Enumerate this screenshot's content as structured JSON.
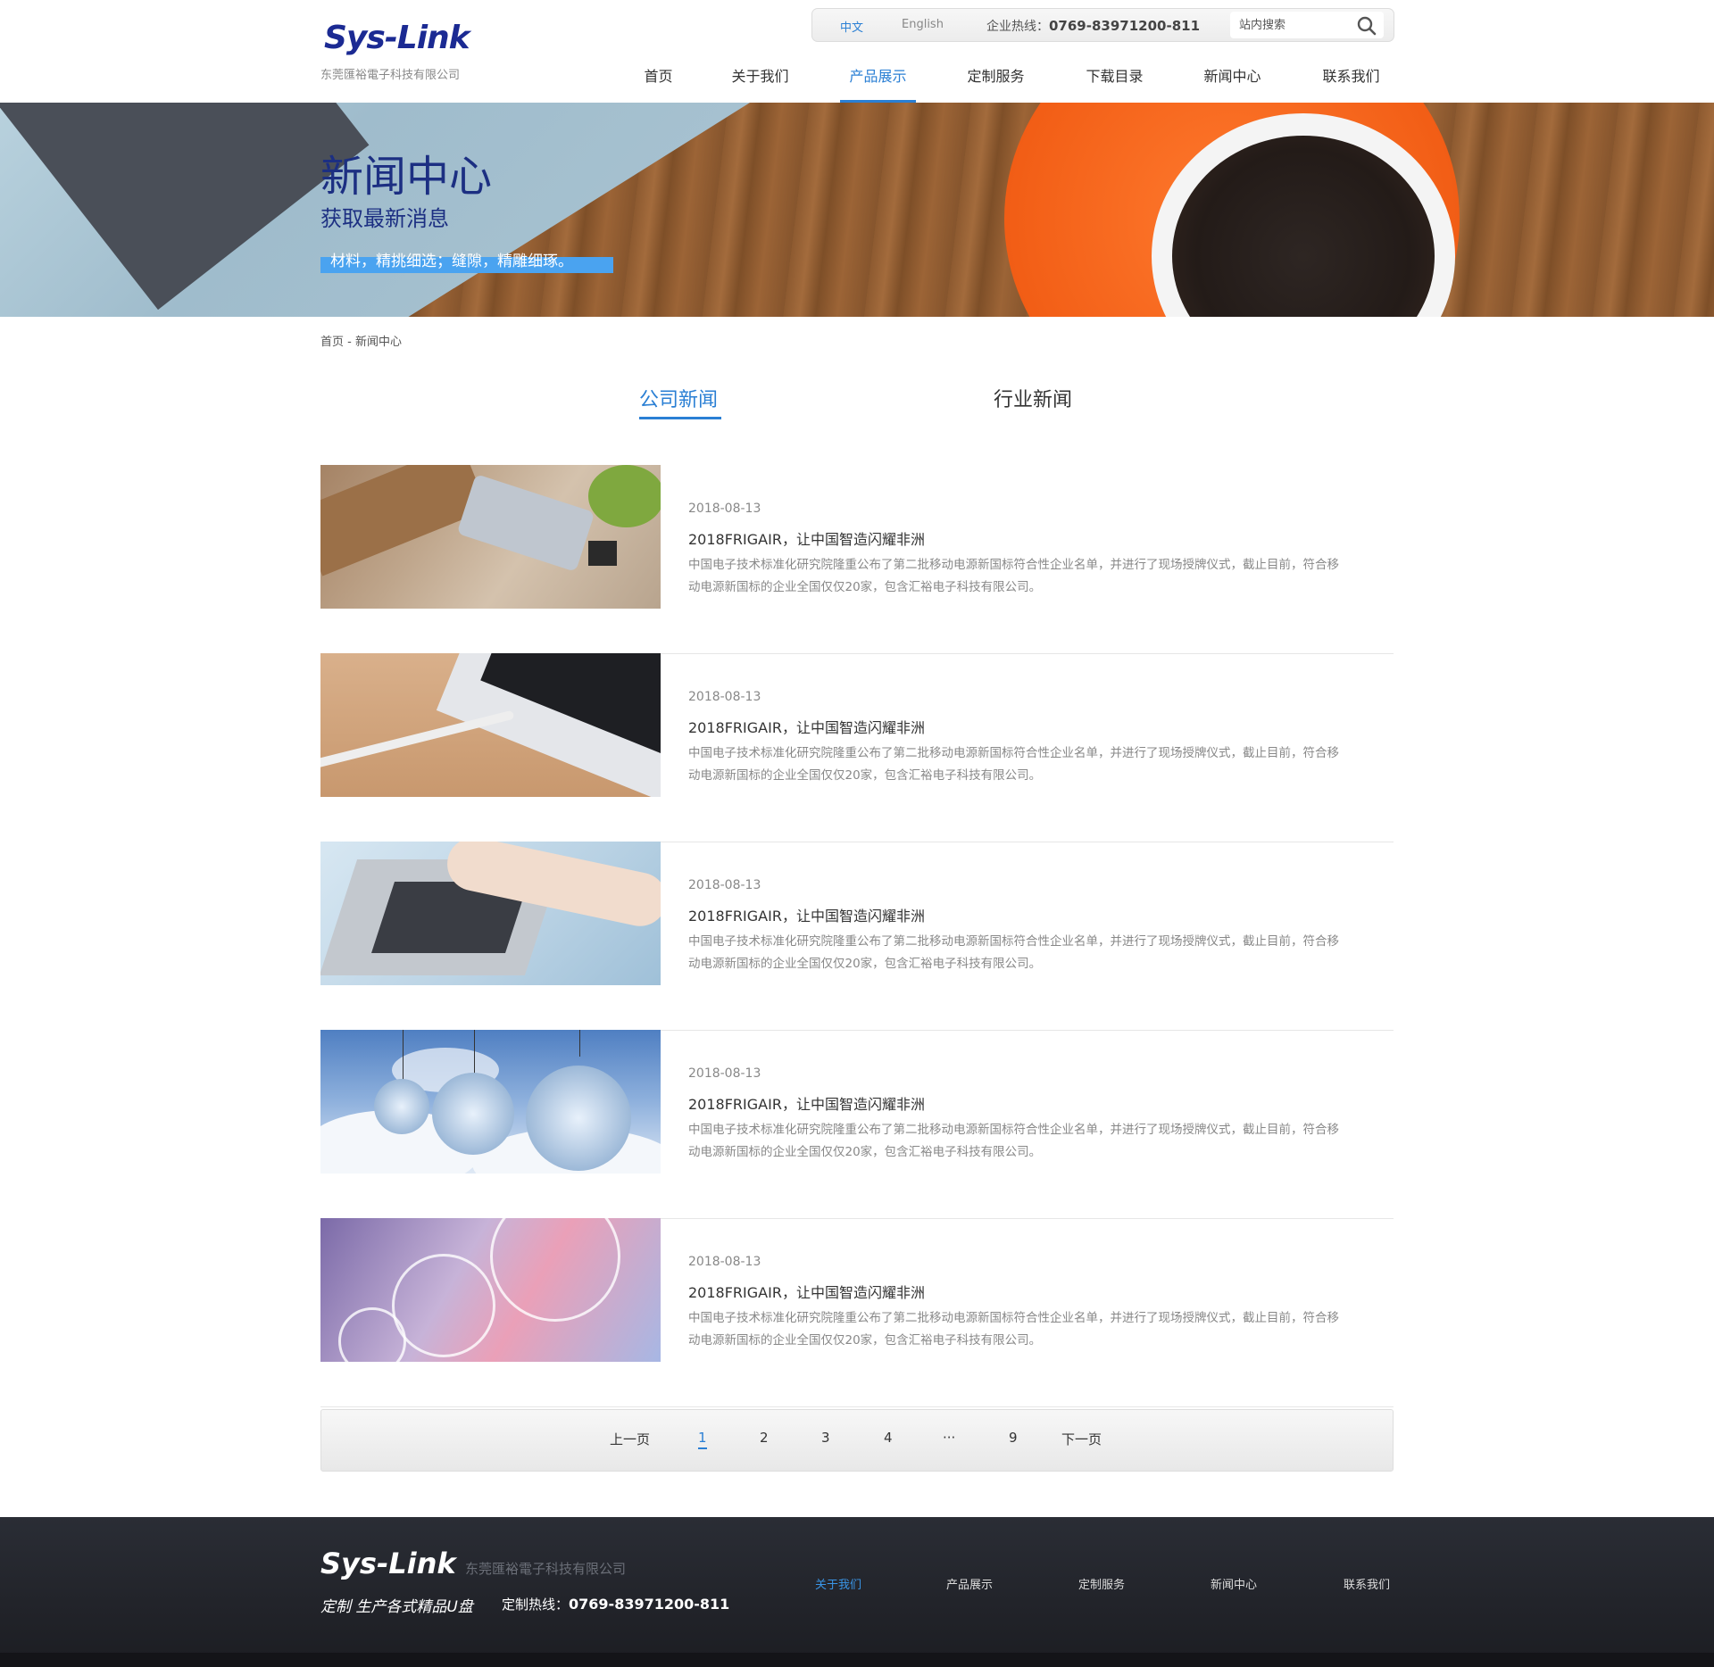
{
  "header": {
    "logo": "Sys-Link",
    "company": "东莞匯裕電子科技有限公司",
    "lang_cn": "中文",
    "lang_en": "English",
    "hotline_label": "企业热线：",
    "hotline_number": "0769-83971200-811",
    "search_placeholder": "站内搜索",
    "search_icon": "search-icon",
    "nav": [
      {
        "label": "首页",
        "active": false
      },
      {
        "label": "关于我们",
        "active": false
      },
      {
        "label": "产品展示",
        "active": true
      },
      {
        "label": "定制服务",
        "active": false
      },
      {
        "label": "下载目录",
        "active": false
      },
      {
        "label": "新闻中心",
        "active": false
      },
      {
        "label": "联系我们",
        "active": false
      }
    ]
  },
  "banner": {
    "title": "新闻中心",
    "subtitle": "获取最新消息",
    "tagline": "材料，精挑细选；缝隙，精雕细琢。"
  },
  "breadcrumb": {
    "home": "首页",
    "separator": "-",
    "current": "新闻中心"
  },
  "tabs": [
    {
      "label": "公司新闻",
      "active": true
    },
    {
      "label": "行业新闻",
      "active": false
    }
  ],
  "news": [
    {
      "date": "2018-08-13",
      "title": "2018FRIGAIR，让中国智造闪耀非洲",
      "desc": "中国电子技术标准化研究院隆重公布了第二批移动电源新国标符合性企业名单，并进行了现场授牌仪式，截止目前，符合移动电源新国标的企业全国仅仅20家，包含汇裕电子科技有限公司。"
    },
    {
      "date": "2018-08-13",
      "title": "2018FRIGAIR，让中国智造闪耀非洲",
      "desc": "中国电子技术标准化研究院隆重公布了第二批移动电源新国标符合性企业名单，并进行了现场授牌仪式，截止目前，符合移动电源新国标的企业全国仅仅20家，包含汇裕电子科技有限公司。"
    },
    {
      "date": "2018-08-13",
      "title": "2018FRIGAIR，让中国智造闪耀非洲",
      "desc": "中国电子技术标准化研究院隆重公布了第二批移动电源新国标符合性企业名单，并进行了现场授牌仪式，截止目前，符合移动电源新国标的企业全国仅仅20家，包含汇裕电子科技有限公司。"
    },
    {
      "date": "2018-08-13",
      "title": "2018FRIGAIR，让中国智造闪耀非洲",
      "desc": "中国电子技术标准化研究院隆重公布了第二批移动电源新国标符合性企业名单，并进行了现场授牌仪式，截止目前，符合移动电源新国标的企业全国仅仅20家，包含汇裕电子科技有限公司。"
    },
    {
      "date": "2018-08-13",
      "title": "2018FRIGAIR，让中国智造闪耀非洲",
      "desc": "中国电子技术标准化研究院隆重公布了第二批移动电源新国标符合性企业名单，并进行了现场授牌仪式，截止目前，符合移动电源新国标的企业全国仅仅20家，包含汇裕电子科技有限公司。"
    }
  ],
  "pagination": {
    "prev": "上一页",
    "pages": [
      "1",
      "2",
      "3",
      "4",
      "···",
      "9"
    ],
    "current": "1",
    "next": "下一页"
  },
  "footer": {
    "logo": "Sys-Link",
    "company": "东莞匯裕電子科技有限公司",
    "slogan": "定制 生产各式精品U盘",
    "hotline_label": "定制热线：",
    "hotline_number": "0769-83971200-811",
    "links": [
      {
        "label": "关于我们",
        "active": true
      },
      {
        "label": "产品展示",
        "active": false
      },
      {
        "label": "定制服务",
        "active": false
      },
      {
        "label": "新闻中心",
        "active": false
      },
      {
        "label": "联系我们",
        "active": false
      }
    ]
  },
  "colors": {
    "accent": "#2a7fd4",
    "brand_navy": "#1b2a93",
    "footer_bg": "#22242b"
  }
}
